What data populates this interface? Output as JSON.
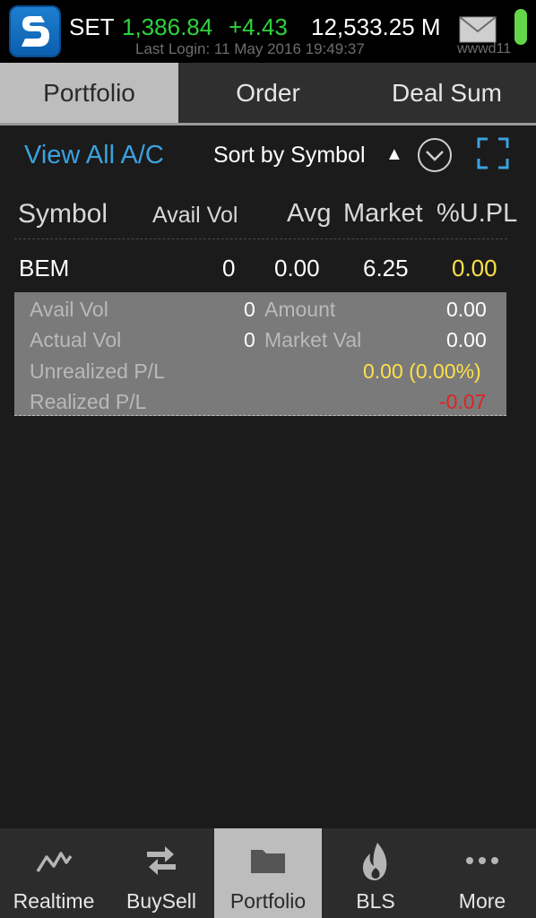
{
  "statusbar": {
    "market": "SET",
    "index": "1,386.84",
    "change": "+4.43",
    "volume": "12,533.25 M",
    "last_login": "Last Login: 11 May 2016 19:49:37",
    "user_id": "wwwd11",
    "colors": {
      "up": "#2fd23b",
      "battery": "#63d64a"
    }
  },
  "tabs": [
    {
      "label": "Portfolio",
      "active": true
    },
    {
      "label": "Order",
      "active": false
    },
    {
      "label": "Deal Sum",
      "active": false
    }
  ],
  "filter": {
    "view_all": "View All A/C",
    "sort": "Sort by Symbol",
    "sort_arrow": "▲"
  },
  "table": {
    "headers": {
      "symbol": "Symbol",
      "avail_vol": "Avail Vol",
      "avg": "Avg",
      "market": "Market",
      "upl": "%U.PL"
    },
    "rows": [
      {
        "symbol": "BEM",
        "avail_vol": "0",
        "avg": "0.00",
        "market": "6.25",
        "upl": "0.00"
      }
    ]
  },
  "detail": {
    "avail_vol_label": "Avail Vol",
    "avail_vol": "0",
    "amount_label": "Amount",
    "amount": "0.00",
    "actual_vol_label": "Actual Vol",
    "actual_vol": "0",
    "market_val_label": "Market Val",
    "market_val": "0.00",
    "unrealized_label": "Unrealized P/L",
    "unrealized": "0.00 (0.00%)",
    "realized_label": "Realized P/L",
    "realized": "-0.07",
    "colors": {
      "positive_neutral": "#ffe04a",
      "negative": "#e02323"
    }
  },
  "bottom_nav": [
    {
      "label": "Realtime",
      "icon": "line-chart-icon",
      "active": false
    },
    {
      "label": "BuySell",
      "icon": "swap-arrows-icon",
      "active": false
    },
    {
      "label": "Portfolio",
      "icon": "folder-icon",
      "active": true
    },
    {
      "label": "BLS",
      "icon": "flame-logo-icon",
      "active": false
    },
    {
      "label": "More",
      "icon": "more-dots-icon",
      "active": false
    }
  ]
}
